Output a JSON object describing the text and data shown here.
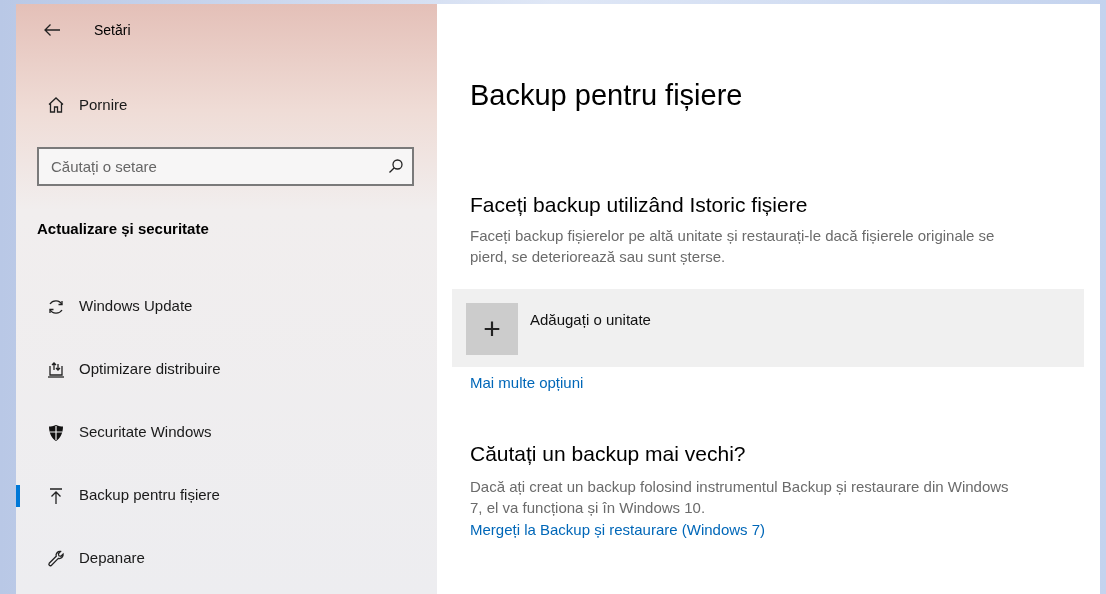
{
  "window": {
    "title": "Setări"
  },
  "sidebar": {
    "home": "Pornire",
    "search": {
      "placeholder": "Căutați o setare"
    },
    "section": "Actualizare și securitate",
    "items": [
      {
        "label": "Windows Update",
        "selected": false
      },
      {
        "label": "Optimizare distribuire",
        "selected": false
      },
      {
        "label": "Securitate Windows",
        "selected": false
      },
      {
        "label": "Backup pentru fișiere",
        "selected": true
      },
      {
        "label": "Depanare",
        "selected": false
      }
    ]
  },
  "content": {
    "title": "Backup pentru fișiere",
    "sections": [
      {
        "heading": "Faceți backup utilizând Istoric fișiere",
        "description": "Faceți backup fișierelor pe altă unitate și restaurați-le dacă fișierele originale se pierd, se deteriorează sau sunt șterse.",
        "add_drive": {
          "icon": "+",
          "label": "Adăugați o unitate"
        },
        "link": "Mai multe opțiuni"
      },
      {
        "heading": "Căutați un backup mai vechi?",
        "description": "Dacă ați creat un backup folosind instrumentul Backup și restaurare din Windows 7, el va funcționa și în Windows 10.",
        "link": "Mergeți la Backup și restaurare (Windows 7)"
      }
    ]
  }
}
